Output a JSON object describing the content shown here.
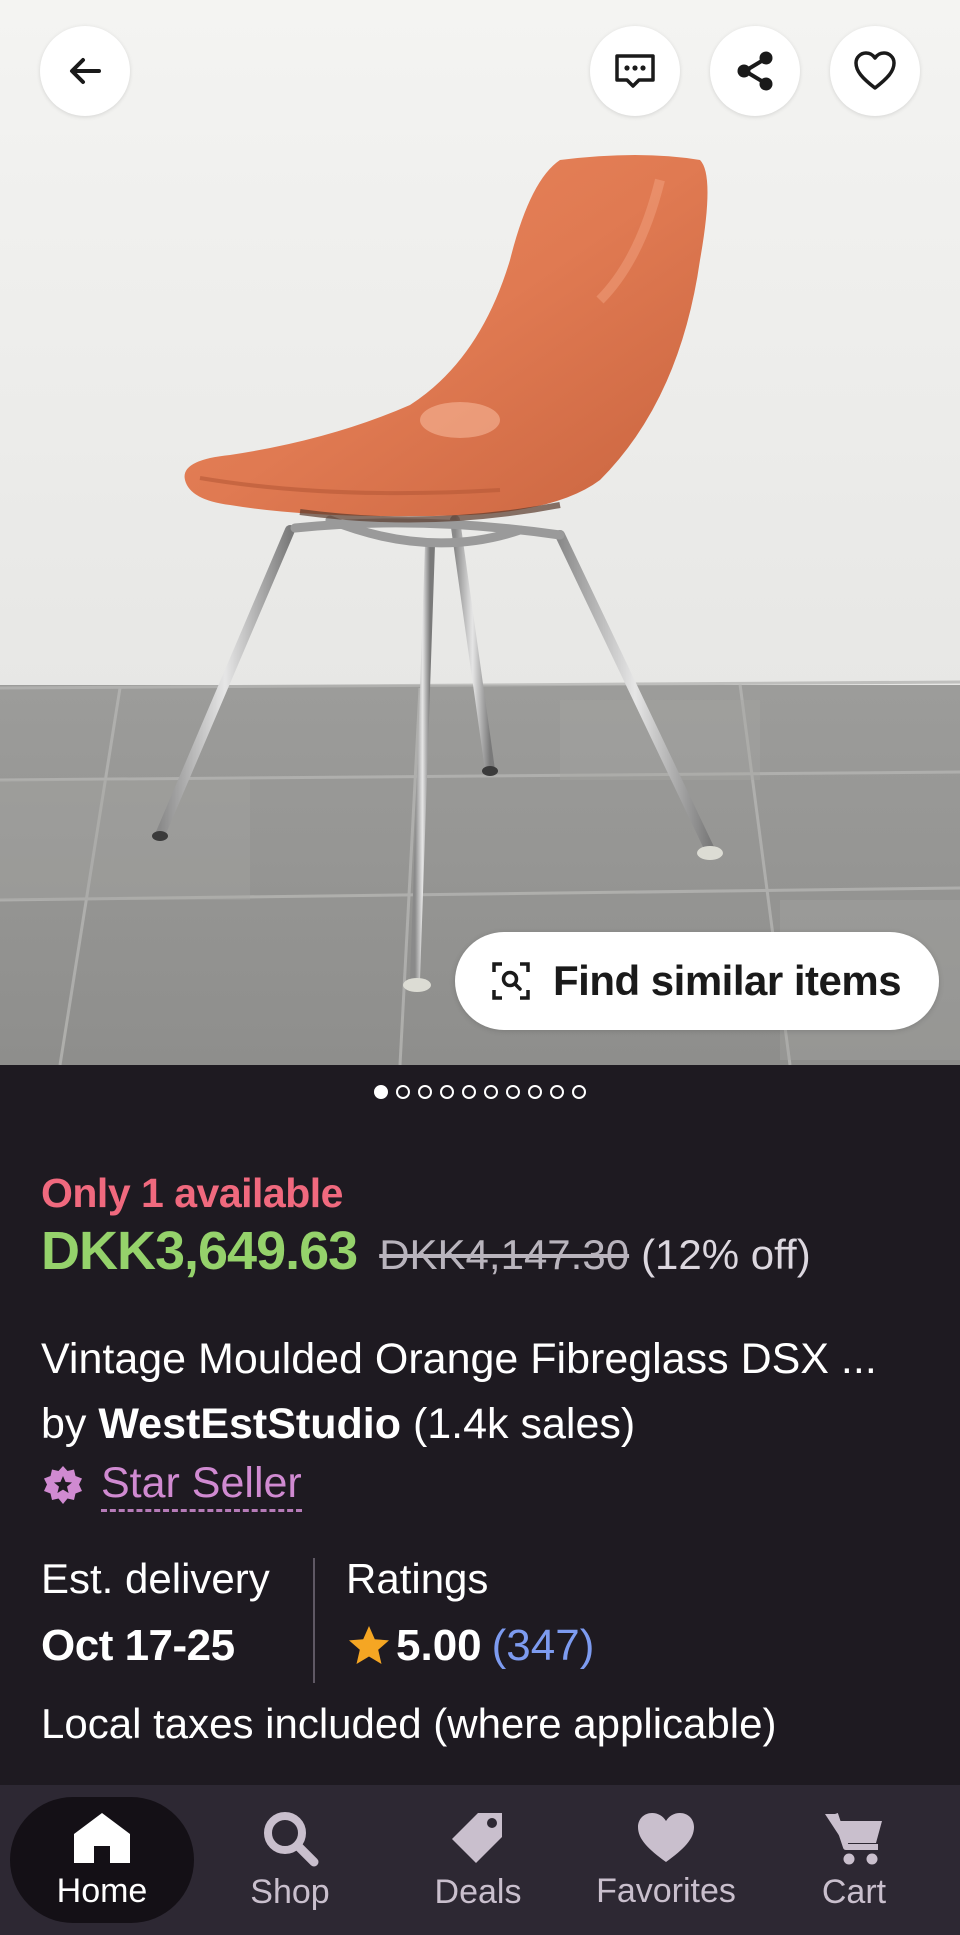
{
  "top_actions": {
    "back_icon": "arrow-left-icon",
    "message_icon": "message-icon",
    "share_icon": "share-icon",
    "favorite_icon": "heart-outline-icon"
  },
  "image": {
    "find_similar_label": "Find similar items",
    "find_similar_icon": "image-search-icon",
    "dot_count": 10,
    "active_dot": 0
  },
  "product": {
    "availability": "Only 1 available",
    "price": "DKK3,649.63",
    "original_price": "DKK4,147.30",
    "discount": "(12% off)",
    "title": "Vintage Moulded Orange Fibreglass DSX ...",
    "seller_prefix": "by ",
    "seller_name": "WestEstStudio",
    "seller_sales": " (1.4k sales)",
    "star_seller_label": "Star Seller",
    "delivery_label": "Est. delivery",
    "delivery_value": "Oct 17-25",
    "ratings_label": "Ratings",
    "rating_score": "5.00",
    "rating_count": "(347)",
    "taxes_note": "Local taxes included (where applicable)"
  },
  "nav": {
    "items": [
      {
        "label": "Home",
        "icon": "home-icon",
        "active": true
      },
      {
        "label": "Shop",
        "icon": "search-icon",
        "active": false
      },
      {
        "label": "Deals",
        "icon": "tag-icon",
        "active": false
      },
      {
        "label": "Favorites",
        "icon": "heart-icon",
        "active": false
      },
      {
        "label": "Cart",
        "icon": "cart-icon",
        "active": false
      }
    ]
  },
  "colors": {
    "background": "#1e1a21",
    "availability": "#f0697e",
    "price": "#95d26b",
    "star_seller": "#d08ad1",
    "rating_count": "#7d9bf0",
    "rating_star": "#f5a623",
    "nav_background": "#2d2833"
  }
}
